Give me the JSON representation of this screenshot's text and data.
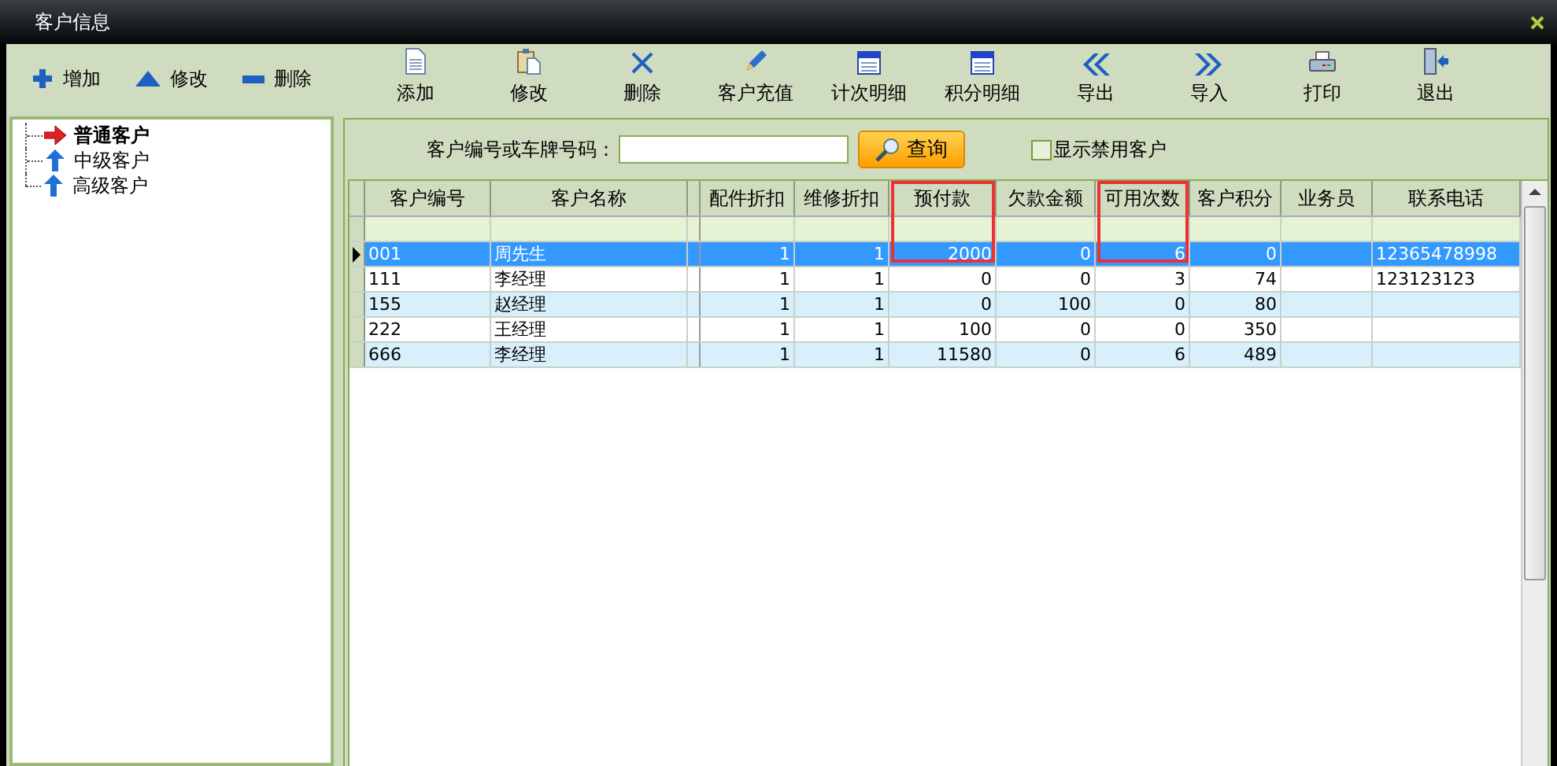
{
  "window": {
    "title": "客户信息"
  },
  "quick_actions": [
    {
      "label": "增加"
    },
    {
      "label": "修改"
    },
    {
      "label": "删除"
    }
  ],
  "tree": [
    {
      "label": "普通客户",
      "selected": true
    },
    {
      "label": "中级客户",
      "selected": false
    },
    {
      "label": "高级客户",
      "selected": false
    }
  ],
  "toolbar": [
    {
      "label": "添加"
    },
    {
      "label": "修改"
    },
    {
      "label": "删除"
    },
    {
      "label": "客户充值"
    },
    {
      "label": "计次明细"
    },
    {
      "label": "积分明细"
    },
    {
      "label": "导出"
    },
    {
      "label": "导入"
    },
    {
      "label": "打印"
    },
    {
      "label": "退出"
    }
  ],
  "search": {
    "label": "客户编号或车牌号码：",
    "button": "查询",
    "checkbox": {
      "label": "显示禁用客户",
      "checked": false
    }
  },
  "table": {
    "columns": [
      {
        "label": "客户编号",
        "kind": "text",
        "highlighted": false
      },
      {
        "label": "客户名称",
        "kind": "text",
        "highlighted": false
      },
      {
        "label": "配件折扣",
        "kind": "number",
        "highlighted": false
      },
      {
        "label": "维修折扣",
        "kind": "number",
        "highlighted": false
      },
      {
        "label": "预付款",
        "kind": "number",
        "highlighted": true
      },
      {
        "label": "欠款金额",
        "kind": "number",
        "highlighted": false
      },
      {
        "label": "可用次数",
        "kind": "number",
        "highlighted": true
      },
      {
        "label": "客户积分",
        "kind": "number",
        "highlighted": false
      },
      {
        "label": "业务员",
        "kind": "text",
        "highlighted": false
      },
      {
        "label": "联系电话",
        "kind": "text",
        "highlighted": false
      }
    ],
    "rows": [
      {
        "selected": true,
        "cells": [
          "001",
          "周先生",
          "1",
          "1",
          "2000",
          "0",
          "6",
          "0",
          "",
          "12365478998"
        ]
      },
      {
        "selected": false,
        "cells": [
          "111",
          "李经理",
          "1",
          "1",
          "0",
          "0",
          "3",
          "74",
          "",
          "123123123"
        ]
      },
      {
        "selected": false,
        "cells": [
          "155",
          "赵经理",
          "1",
          "1",
          "0",
          "100",
          "0",
          "80",
          "",
          ""
        ]
      },
      {
        "selected": false,
        "cells": [
          "222",
          "王经理",
          "1",
          "1",
          "100",
          "0",
          "0",
          "350",
          "",
          ""
        ]
      },
      {
        "selected": false,
        "cells": [
          "666",
          "李经理",
          "1",
          "1",
          "11580",
          "0",
          "6",
          "489",
          "",
          ""
        ]
      }
    ]
  }
}
